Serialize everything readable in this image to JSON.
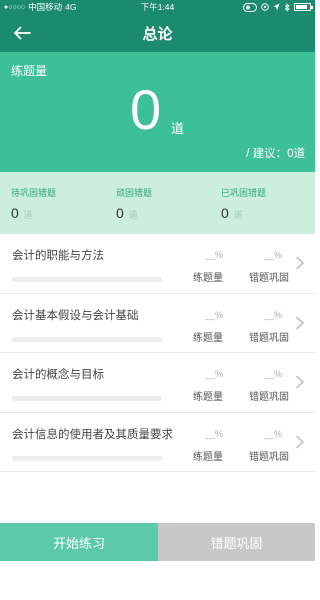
{
  "status_bar": {
    "signal_dots": "●○○○○",
    "carrier": "中国移动",
    "network": "4G",
    "time": "下午1:44",
    "battery_level": 0.85
  },
  "nav": {
    "title": "总论",
    "back_icon": "arrow-left-icon"
  },
  "hero": {
    "label": "练题量",
    "count": "0",
    "unit": "道",
    "suggestion": "/ 建议：0道"
  },
  "stats": [
    {
      "label": "待巩固错题",
      "value": "0",
      "unit": "道"
    },
    {
      "label": "顽固错题",
      "value": "0",
      "unit": "道"
    },
    {
      "label": "已巩固错题",
      "value": "0",
      "unit": "道"
    }
  ],
  "chapters": [
    {
      "title": "会计的职能与方法",
      "practice_pct": "__%",
      "review_pct": "__%",
      "practice_label": "练题量",
      "review_label": "错题巩固",
      "progress": 0
    },
    {
      "title": "会计基本假设与会计基础",
      "practice_pct": "__%",
      "review_pct": "__%",
      "practice_label": "练题量",
      "review_label": "错题巩固",
      "progress": 0
    },
    {
      "title": "会计的概念与目标",
      "practice_pct": "__%",
      "review_pct": "__%",
      "practice_label": "练题量",
      "review_label": "错题巩固",
      "progress": 0
    },
    {
      "title": "会计信息的使用者及其质量要求",
      "practice_pct": "__%",
      "review_pct": "__%",
      "practice_label": "练题量",
      "review_label": "错题巩固",
      "progress": 0
    }
  ],
  "buttons": {
    "start": "开始练习",
    "review": "错题巩固"
  },
  "colors": {
    "header": "#1c8a6f",
    "accent": "#3dbf98",
    "stats_bg": "#cceedd",
    "start_button": "#5ccaa8",
    "disabled_button": "#c8c8c8"
  }
}
